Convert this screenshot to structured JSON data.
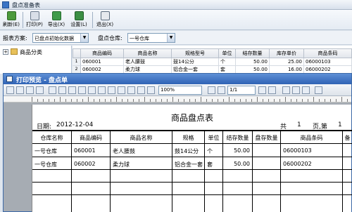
{
  "app": {
    "title": "盘点准备表"
  },
  "toolbar": {
    "refresh": "刷新(E)",
    "print": "打印(P)",
    "export": "导出(X)",
    "settings": "设置(L)",
    "exit": "退出(X)"
  },
  "filter": {
    "plan_label": "报表方案:",
    "plan_value": "已盘点初始化数据",
    "warehouse_label": "盘点仓库:",
    "warehouse_value": "一号仓库"
  },
  "tree": {
    "root": "商品分类"
  },
  "grid": {
    "columns": [
      "商品编码",
      "商品名称",
      "规格型号",
      "单位",
      "结存数量",
      "库存单价",
      "商品条码"
    ],
    "rows": [
      {
        "num": "1",
        "cells": [
          "060001",
          "老人腰鼓",
          "鼓14公分",
          "个",
          "50.00",
          "25.00",
          "06000103"
        ]
      },
      {
        "num": "2",
        "cells": [
          "060002",
          "柔力球",
          "铝合金一套",
          "套",
          "50.00",
          "16.00",
          "06000202"
        ]
      }
    ]
  },
  "preview": {
    "title": "打印预览 - 盘点单",
    "zoom": "100%",
    "page_value": "1/1",
    "report": {
      "title": "商品盘点表",
      "date_label": "日期:",
      "date": "2012-12-04",
      "total_label": "共",
      "total_pages": "1",
      "page_label": "页,第",
      "page_no": "1",
      "columns": [
        "仓库名称",
        "商品编码",
        "商品名称",
        "规格",
        "单位",
        "结存数量",
        "盘存数量",
        "商品条码",
        "备"
      ],
      "rows": [
        [
          "一号仓库",
          "060001",
          "老人腰鼓",
          "鼓14公分",
          "个",
          "50.00",
          "",
          "06000103",
          ""
        ],
        [
          "一号仓库",
          "060002",
          "柔力球",
          "铝合金一套",
          "套",
          "50.00",
          "",
          "06000202",
          ""
        ]
      ]
    }
  },
  "colors": {
    "title_blue": "#2f63b5",
    "window_bg": "#dfe6ee"
  }
}
